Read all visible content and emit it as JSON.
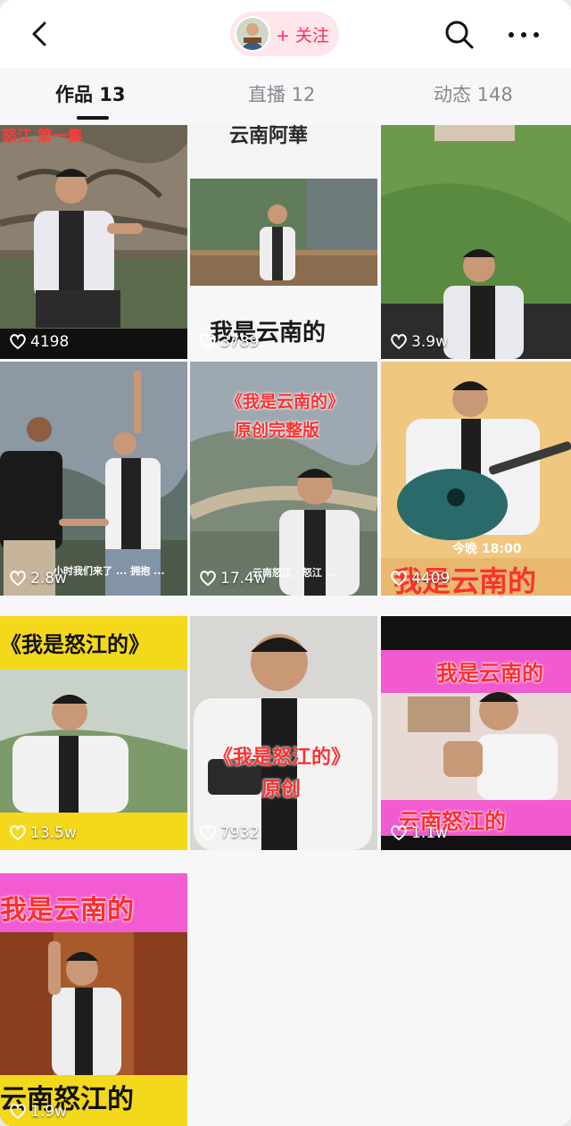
{
  "header": {
    "follow_label": "+ 关注"
  },
  "tabs": [
    {
      "label": "作品 13"
    },
    {
      "label": "直播 12"
    },
    {
      "label": "动态 148"
    }
  ],
  "videos": [
    {
      "likes": "4198",
      "caption_top": "怒江 第一集",
      "caption_bottom": ""
    },
    {
      "likes": "3789",
      "caption_top": "云南阿華",
      "caption_bottom": "我是云南的"
    },
    {
      "likes": "3.9w",
      "caption_top": "",
      "caption_bottom": ""
    },
    {
      "likes": "2.8w",
      "caption_top": "",
      "caption_bottom": "小时我们来了 ... 拥抱 ..."
    },
    {
      "likes": "17.4w",
      "caption_top": "《我是云南的》",
      "caption_mid": "原创完整版",
      "caption_bottom": "云南怒江 · 怒江 ..."
    },
    {
      "likes": "4409",
      "caption_top": "今晚 18:00",
      "caption_bottom": "我是云南的"
    },
    {
      "likes": "13.5w",
      "caption_top": "《我是怒江的》",
      "caption_bottom": ""
    },
    {
      "likes": "7932",
      "caption_top": "《我是怒江的》",
      "caption_mid": "原创",
      "caption_bottom": ""
    },
    {
      "likes": "1.1w",
      "caption_top": "我是云南的",
      "caption_bottom": "云南怒江的"
    },
    {
      "likes": "1.9w",
      "caption_top": "我是云南的",
      "caption_bottom": "云南怒江的"
    }
  ],
  "colors": {
    "accent": "#fe2c55",
    "follow_bg": "#ffe6ea",
    "caption_red": "#ff3b3b",
    "caption_yellow": "#f4d81c",
    "pink_banner": "#f15ad0"
  }
}
